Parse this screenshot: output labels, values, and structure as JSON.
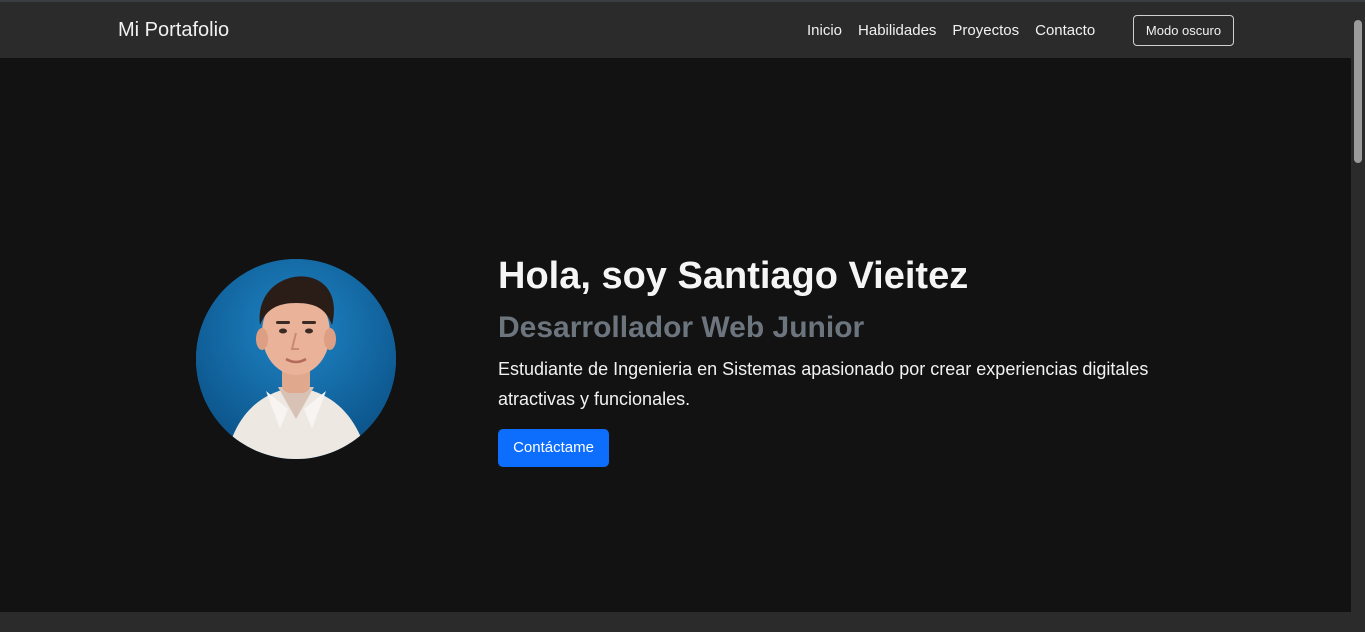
{
  "navbar": {
    "brand": "Mi Portafolio",
    "links": [
      "Inicio",
      "Habilidades",
      "Proyectos",
      "Contacto"
    ],
    "theme_toggle": "Modo oscuro"
  },
  "hero": {
    "title": "Hola, soy Santiago Vieitez",
    "subtitle": "Desarrollador Web Junior",
    "description": "Estudiante de Ingenieria en Sistemas apasionado por crear experiencias digitales atractivas y funcionales.",
    "cta": "Contáctame"
  },
  "colors": {
    "navbar_bg": "#2b2b2b",
    "hero_bg": "#121212",
    "primary": "#0d6efd",
    "subtitle": "#6c757d",
    "text": "#f1f1f1"
  },
  "icons": {
    "avatar": "profile-photo"
  }
}
